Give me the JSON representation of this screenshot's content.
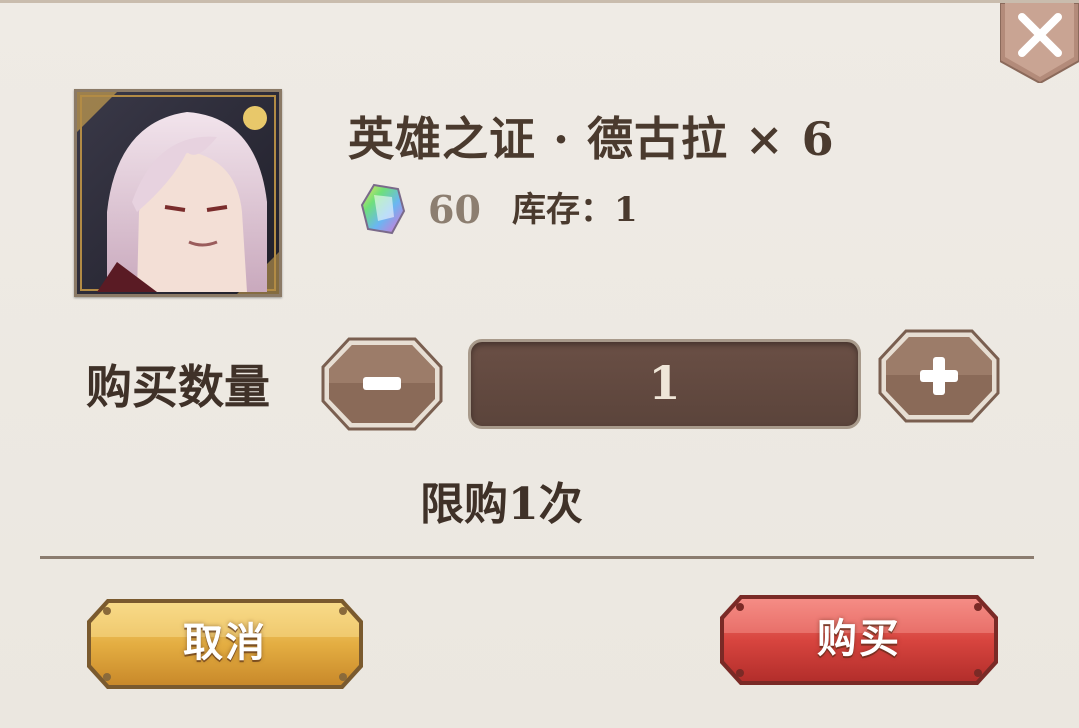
{
  "dialog": {
    "close_icon": "close-x-icon",
    "item": {
      "name": "英雄之证 · 德古拉 × 6",
      "portrait_icon": "dracula-character-portrait",
      "currency_icon": "rainbow-gem-icon",
      "price": "60",
      "stock": "库存：1"
    },
    "quantity": {
      "label": "购买数量",
      "value": "1",
      "minus_icon": "minus-icon",
      "plus_icon": "plus-icon"
    },
    "limit_text": "限购1次",
    "buttons": {
      "cancel": "取消",
      "buy": "购买"
    },
    "colors": {
      "panel": "#ece8e2",
      "text_dark": "#4a3a2e",
      "cancel_gold": "#e0aa3c",
      "buy_red": "#d6453e",
      "stepper_brown": "#8a6a58"
    }
  }
}
